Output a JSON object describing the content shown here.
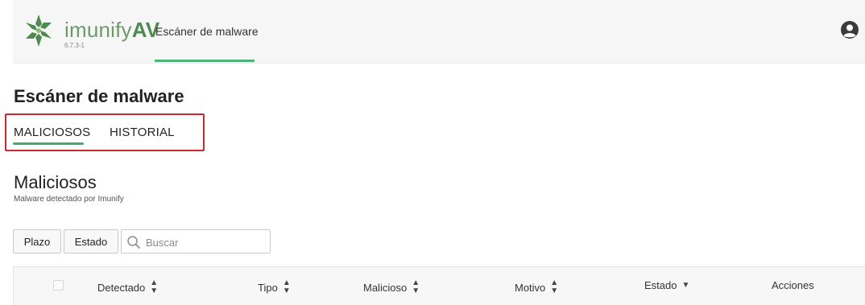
{
  "header": {
    "brand_light": "imunify",
    "brand_bold": "AV",
    "version": "6.7.3-1",
    "active_tab": "Escáner de malware"
  },
  "page": {
    "title": "Escáner de malware"
  },
  "tabs": [
    {
      "label": "MALICIOSOS",
      "active": true
    },
    {
      "label": "HISTORIAL",
      "active": false
    }
  ],
  "section": {
    "title": "Maliciosos",
    "subtitle": "Malware detectado por Imunify"
  },
  "toolbar": {
    "plazo_label": "Plazo",
    "estado_label": "Estado",
    "search_placeholder": "Buscar"
  },
  "table": {
    "columns": [
      {
        "label": "Detectado",
        "sort": "both"
      },
      {
        "label": "Tipo",
        "sort": "both"
      },
      {
        "label": "Malicioso",
        "sort": "both"
      },
      {
        "label": "Motivo",
        "sort": "both"
      },
      {
        "label": "Estado",
        "sort": "down"
      },
      {
        "label": "Acciones",
        "sort": "none"
      }
    ]
  },
  "colors": {
    "accent_green": "#3fae6d",
    "highlight_red": "#c8282e",
    "brand_green": "#4d8a4f"
  },
  "icons": [
    "imunify-logo-icon",
    "user-avatar-icon",
    "search-icon",
    "sort-icon",
    "sort-down-icon"
  ]
}
